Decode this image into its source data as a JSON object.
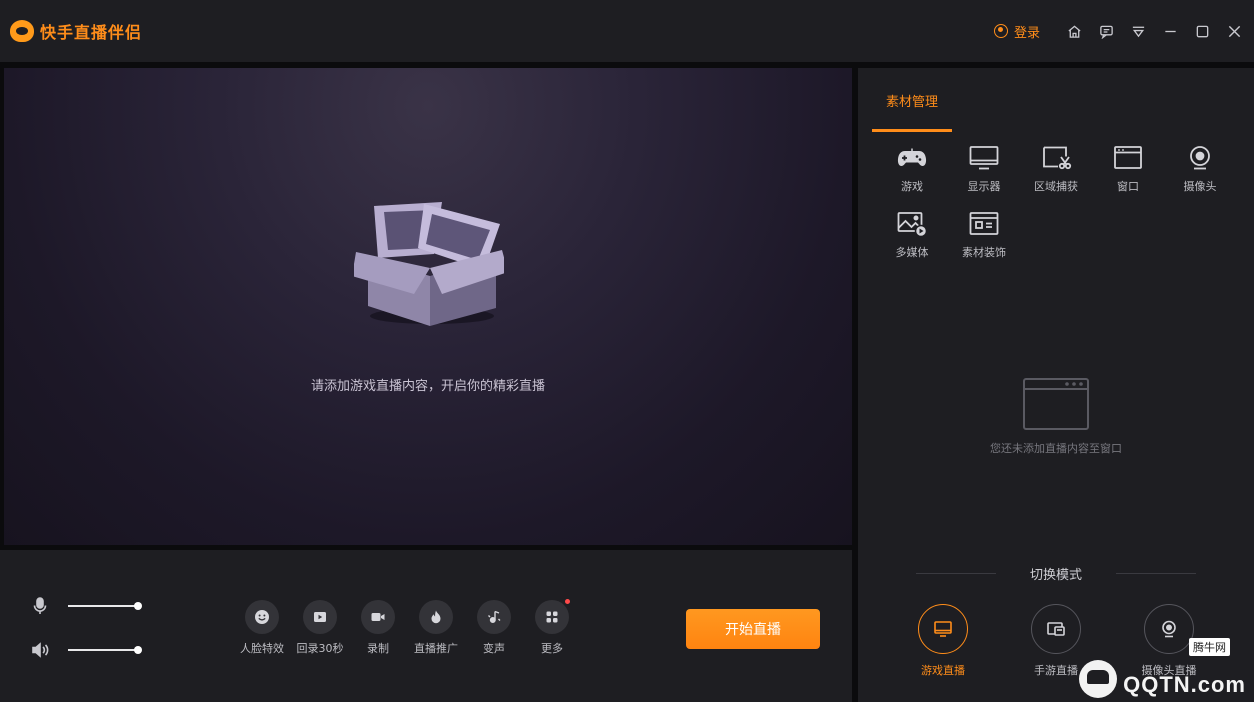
{
  "app": {
    "name": "快手直播伴侣"
  },
  "titlebar": {
    "login_label": "登录"
  },
  "preview": {
    "message": "请添加游戏直播内容，开启你的精彩直播"
  },
  "controls": {
    "tools": [
      {
        "label": "人脸特效",
        "icon": "face-effect-icon"
      },
      {
        "label": "回录30秒",
        "icon": "replay-icon"
      },
      {
        "label": "录制",
        "icon": "record-icon"
      },
      {
        "label": "直播推广",
        "icon": "flame-icon"
      },
      {
        "label": "变声",
        "icon": "voice-change-icon"
      },
      {
        "label": "更多",
        "icon": "more-grid-icon"
      }
    ],
    "start_label": "开始直播",
    "mic_level": 1.0,
    "speaker_level": 1.0
  },
  "right_panel": {
    "tab_label": "素材管理",
    "sources": [
      {
        "label": "游戏",
        "icon": "gamepad-icon"
      },
      {
        "label": "显示器",
        "icon": "monitor-icon"
      },
      {
        "label": "区域捕获",
        "icon": "region-capture-icon"
      },
      {
        "label": "窗口",
        "icon": "window-icon"
      },
      {
        "label": "摄像头",
        "icon": "camera-icon"
      },
      {
        "label": "多媒体",
        "icon": "media-icon"
      },
      {
        "label": "素材装饰",
        "icon": "decoration-icon"
      }
    ],
    "empty_text": "您还未添加直播内容至窗口",
    "mode_title": "切换模式",
    "modes": [
      {
        "label": "游戏直播",
        "icon": "monitor-icon",
        "active": true
      },
      {
        "label": "手游直播",
        "icon": "phone-screen-icon",
        "active": false
      },
      {
        "label": "摄像头直播",
        "icon": "camera-icon",
        "active": false
      }
    ]
  },
  "watermark": {
    "badge": "腾牛网",
    "text": "QQTN.com"
  },
  "colors": {
    "accent": "#ff8d1a",
    "panel": "#1e1e22",
    "background": "#0b0b0d"
  }
}
